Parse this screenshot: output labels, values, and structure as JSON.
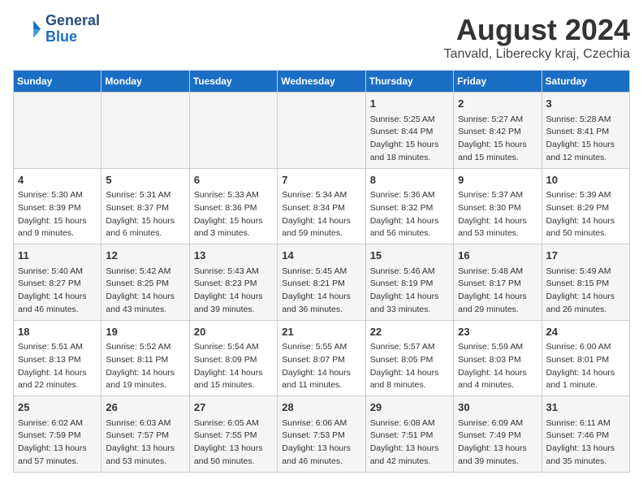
{
  "header": {
    "logo": {
      "line1": "General",
      "line2": "Blue"
    },
    "title": "August 2024",
    "subtitle": "Tanvald, Liberecky kraj, Czechia"
  },
  "weekdays": [
    "Sunday",
    "Monday",
    "Tuesday",
    "Wednesday",
    "Thursday",
    "Friday",
    "Saturday"
  ],
  "weeks": [
    [
      {
        "day": "",
        "content": ""
      },
      {
        "day": "",
        "content": ""
      },
      {
        "day": "",
        "content": ""
      },
      {
        "day": "",
        "content": ""
      },
      {
        "day": "1",
        "content": "Sunrise: 5:25 AM\nSunset: 8:44 PM\nDaylight: 15 hours\nand 18 minutes."
      },
      {
        "day": "2",
        "content": "Sunrise: 5:27 AM\nSunset: 8:42 PM\nDaylight: 15 hours\nand 15 minutes."
      },
      {
        "day": "3",
        "content": "Sunrise: 5:28 AM\nSunset: 8:41 PM\nDaylight: 15 hours\nand 12 minutes."
      }
    ],
    [
      {
        "day": "4",
        "content": "Sunrise: 5:30 AM\nSunset: 8:39 PM\nDaylight: 15 hours\nand 9 minutes."
      },
      {
        "day": "5",
        "content": "Sunrise: 5:31 AM\nSunset: 8:37 PM\nDaylight: 15 hours\nand 6 minutes."
      },
      {
        "day": "6",
        "content": "Sunrise: 5:33 AM\nSunset: 8:36 PM\nDaylight: 15 hours\nand 3 minutes."
      },
      {
        "day": "7",
        "content": "Sunrise: 5:34 AM\nSunset: 8:34 PM\nDaylight: 14 hours\nand 59 minutes."
      },
      {
        "day": "8",
        "content": "Sunrise: 5:36 AM\nSunset: 8:32 PM\nDaylight: 14 hours\nand 56 minutes."
      },
      {
        "day": "9",
        "content": "Sunrise: 5:37 AM\nSunset: 8:30 PM\nDaylight: 14 hours\nand 53 minutes."
      },
      {
        "day": "10",
        "content": "Sunrise: 5:39 AM\nSunset: 8:29 PM\nDaylight: 14 hours\nand 50 minutes."
      }
    ],
    [
      {
        "day": "11",
        "content": "Sunrise: 5:40 AM\nSunset: 8:27 PM\nDaylight: 14 hours\nand 46 minutes."
      },
      {
        "day": "12",
        "content": "Sunrise: 5:42 AM\nSunset: 8:25 PM\nDaylight: 14 hours\nand 43 minutes."
      },
      {
        "day": "13",
        "content": "Sunrise: 5:43 AM\nSunset: 8:23 PM\nDaylight: 14 hours\nand 39 minutes."
      },
      {
        "day": "14",
        "content": "Sunrise: 5:45 AM\nSunset: 8:21 PM\nDaylight: 14 hours\nand 36 minutes."
      },
      {
        "day": "15",
        "content": "Sunrise: 5:46 AM\nSunset: 8:19 PM\nDaylight: 14 hours\nand 33 minutes."
      },
      {
        "day": "16",
        "content": "Sunrise: 5:48 AM\nSunset: 8:17 PM\nDaylight: 14 hours\nand 29 minutes."
      },
      {
        "day": "17",
        "content": "Sunrise: 5:49 AM\nSunset: 8:15 PM\nDaylight: 14 hours\nand 26 minutes."
      }
    ],
    [
      {
        "day": "18",
        "content": "Sunrise: 5:51 AM\nSunset: 8:13 PM\nDaylight: 14 hours\nand 22 minutes."
      },
      {
        "day": "19",
        "content": "Sunrise: 5:52 AM\nSunset: 8:11 PM\nDaylight: 14 hours\nand 19 minutes."
      },
      {
        "day": "20",
        "content": "Sunrise: 5:54 AM\nSunset: 8:09 PM\nDaylight: 14 hours\nand 15 minutes."
      },
      {
        "day": "21",
        "content": "Sunrise: 5:55 AM\nSunset: 8:07 PM\nDaylight: 14 hours\nand 11 minutes."
      },
      {
        "day": "22",
        "content": "Sunrise: 5:57 AM\nSunset: 8:05 PM\nDaylight: 14 hours\nand 8 minutes."
      },
      {
        "day": "23",
        "content": "Sunrise: 5:59 AM\nSunset: 8:03 PM\nDaylight: 14 hours\nand 4 minutes."
      },
      {
        "day": "24",
        "content": "Sunrise: 6:00 AM\nSunset: 8:01 PM\nDaylight: 14 hours\nand 1 minute."
      }
    ],
    [
      {
        "day": "25",
        "content": "Sunrise: 6:02 AM\nSunset: 7:59 PM\nDaylight: 13 hours\nand 57 minutes."
      },
      {
        "day": "26",
        "content": "Sunrise: 6:03 AM\nSunset: 7:57 PM\nDaylight: 13 hours\nand 53 minutes."
      },
      {
        "day": "27",
        "content": "Sunrise: 6:05 AM\nSunset: 7:55 PM\nDaylight: 13 hours\nand 50 minutes."
      },
      {
        "day": "28",
        "content": "Sunrise: 6:06 AM\nSunset: 7:53 PM\nDaylight: 13 hours\nand 46 minutes."
      },
      {
        "day": "29",
        "content": "Sunrise: 6:08 AM\nSunset: 7:51 PM\nDaylight: 13 hours\nand 42 minutes."
      },
      {
        "day": "30",
        "content": "Sunrise: 6:09 AM\nSunset: 7:49 PM\nDaylight: 13 hours\nand 39 minutes."
      },
      {
        "day": "31",
        "content": "Sunrise: 6:11 AM\nSunset: 7:46 PM\nDaylight: 13 hours\nand 35 minutes."
      }
    ]
  ]
}
